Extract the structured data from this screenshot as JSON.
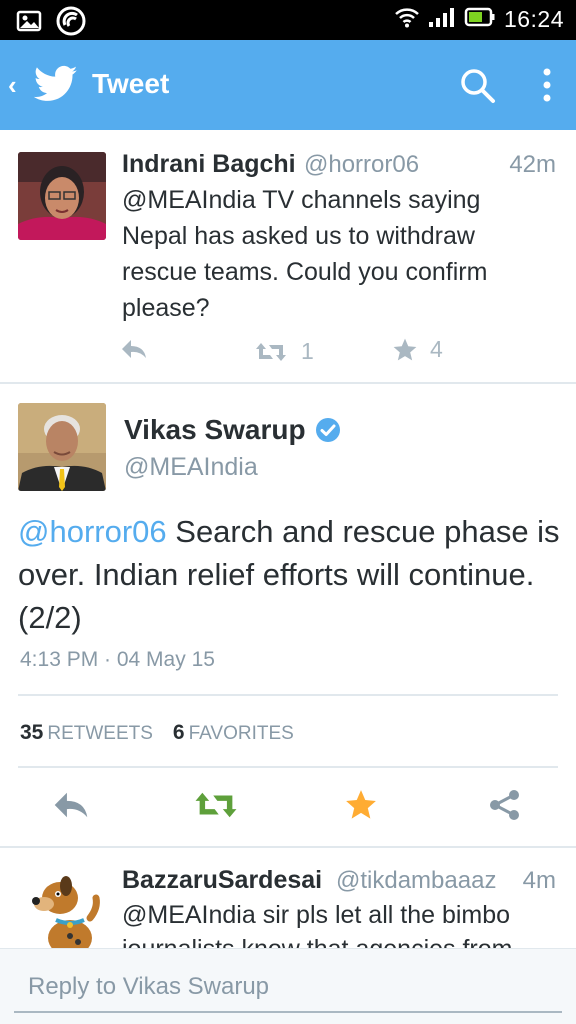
{
  "status_bar": {
    "time": "16:24"
  },
  "app_bar": {
    "title": "Tweet"
  },
  "tweets": [
    {
      "name": "Indrani Bagchi",
      "handle": "@horror06",
      "time": "42m",
      "text": "@MEAIndia TV channels saying Nepal has asked us to withdraw rescue teams. Could you confirm please?",
      "retweets": "1",
      "favorites": "4"
    }
  ],
  "main_tweet": {
    "name": "Vikas Swarup",
    "handle": "@MEAIndia",
    "mention": "@horror06",
    "text": " Search and rescue phase is over. Indian relief efforts will continue. (2/2)",
    "timestamp": "4:13 PM · 04 May 15",
    "retweet_count": "35",
    "retweet_label": "RETWEETS",
    "favorite_count": "6",
    "favorite_label": "FAVORITES"
  },
  "next_tweet": {
    "name": "BazzaruSardesai",
    "handle": "@tikdambaaaz",
    "time": "4m",
    "text": "@MEAIndia sir pls let all the bimbo journalists know that agencies from"
  },
  "reply": {
    "placeholder": "Reply to Vikas Swarup"
  },
  "colors": {
    "brand": "#55acee",
    "retweet_green": "#5ea03b",
    "favorite_gold": "#ffac33",
    "muted": "#8899a6"
  }
}
